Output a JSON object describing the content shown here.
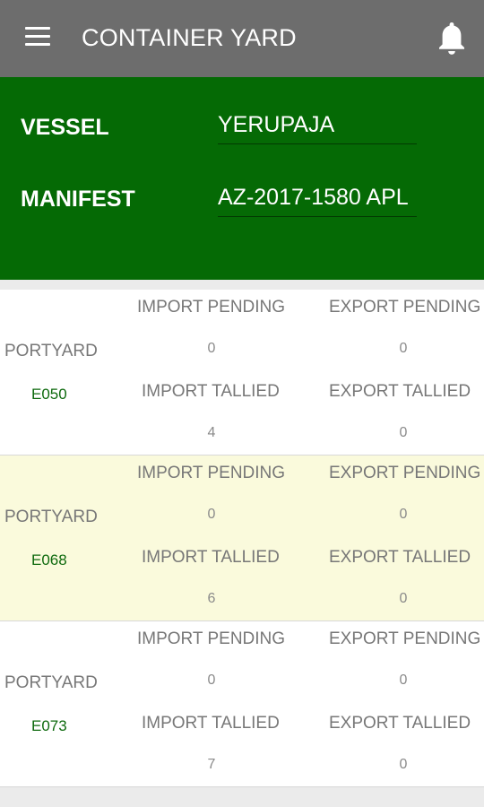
{
  "appbar": {
    "title": "CONTAINER YARD",
    "menu_icon": "hamburger-menu-icon",
    "notification_icon": "bell-icon"
  },
  "header": {
    "vessel_label": "VESSEL",
    "vessel_value": "YERUPAJA",
    "manifest_label": "MANIFEST",
    "manifest_value": "AZ-2017-1580 APL"
  },
  "colors": {
    "appbar": "#6d6d6d",
    "header": "#056a05",
    "highlight_row": "#fafadc",
    "portyard_code": "#0e6a0e"
  },
  "yards": [
    {
      "portyard_label": "PORTYARD",
      "code": "E050",
      "import_pending_label": "IMPORT PENDING",
      "import_pending": "0",
      "export_pending_label": "EXPORT PENDING",
      "export_pending": "0",
      "import_tallied_label": "IMPORT TALLIED",
      "import_tallied": "4",
      "export_tallied_label": "EXPORT TALLIED",
      "export_tallied": "0"
    },
    {
      "portyard_label": "PORTYARD",
      "code": "E068",
      "import_pending_label": "IMPORT PENDING",
      "import_pending": "0",
      "export_pending_label": "EXPORT PENDING",
      "export_pending": "0",
      "import_tallied_label": "IMPORT TALLIED",
      "import_tallied": "6",
      "export_tallied_label": "EXPORT TALLIED",
      "export_tallied": "0"
    },
    {
      "portyard_label": "PORTYARD",
      "code": "E073",
      "import_pending_label": "IMPORT PENDING",
      "import_pending": "0",
      "export_pending_label": "EXPORT PENDING",
      "export_pending": "0",
      "import_tallied_label": "IMPORT TALLIED",
      "import_tallied": "7",
      "export_tallied_label": "EXPORT TALLIED",
      "export_tallied": "0"
    }
  ]
}
